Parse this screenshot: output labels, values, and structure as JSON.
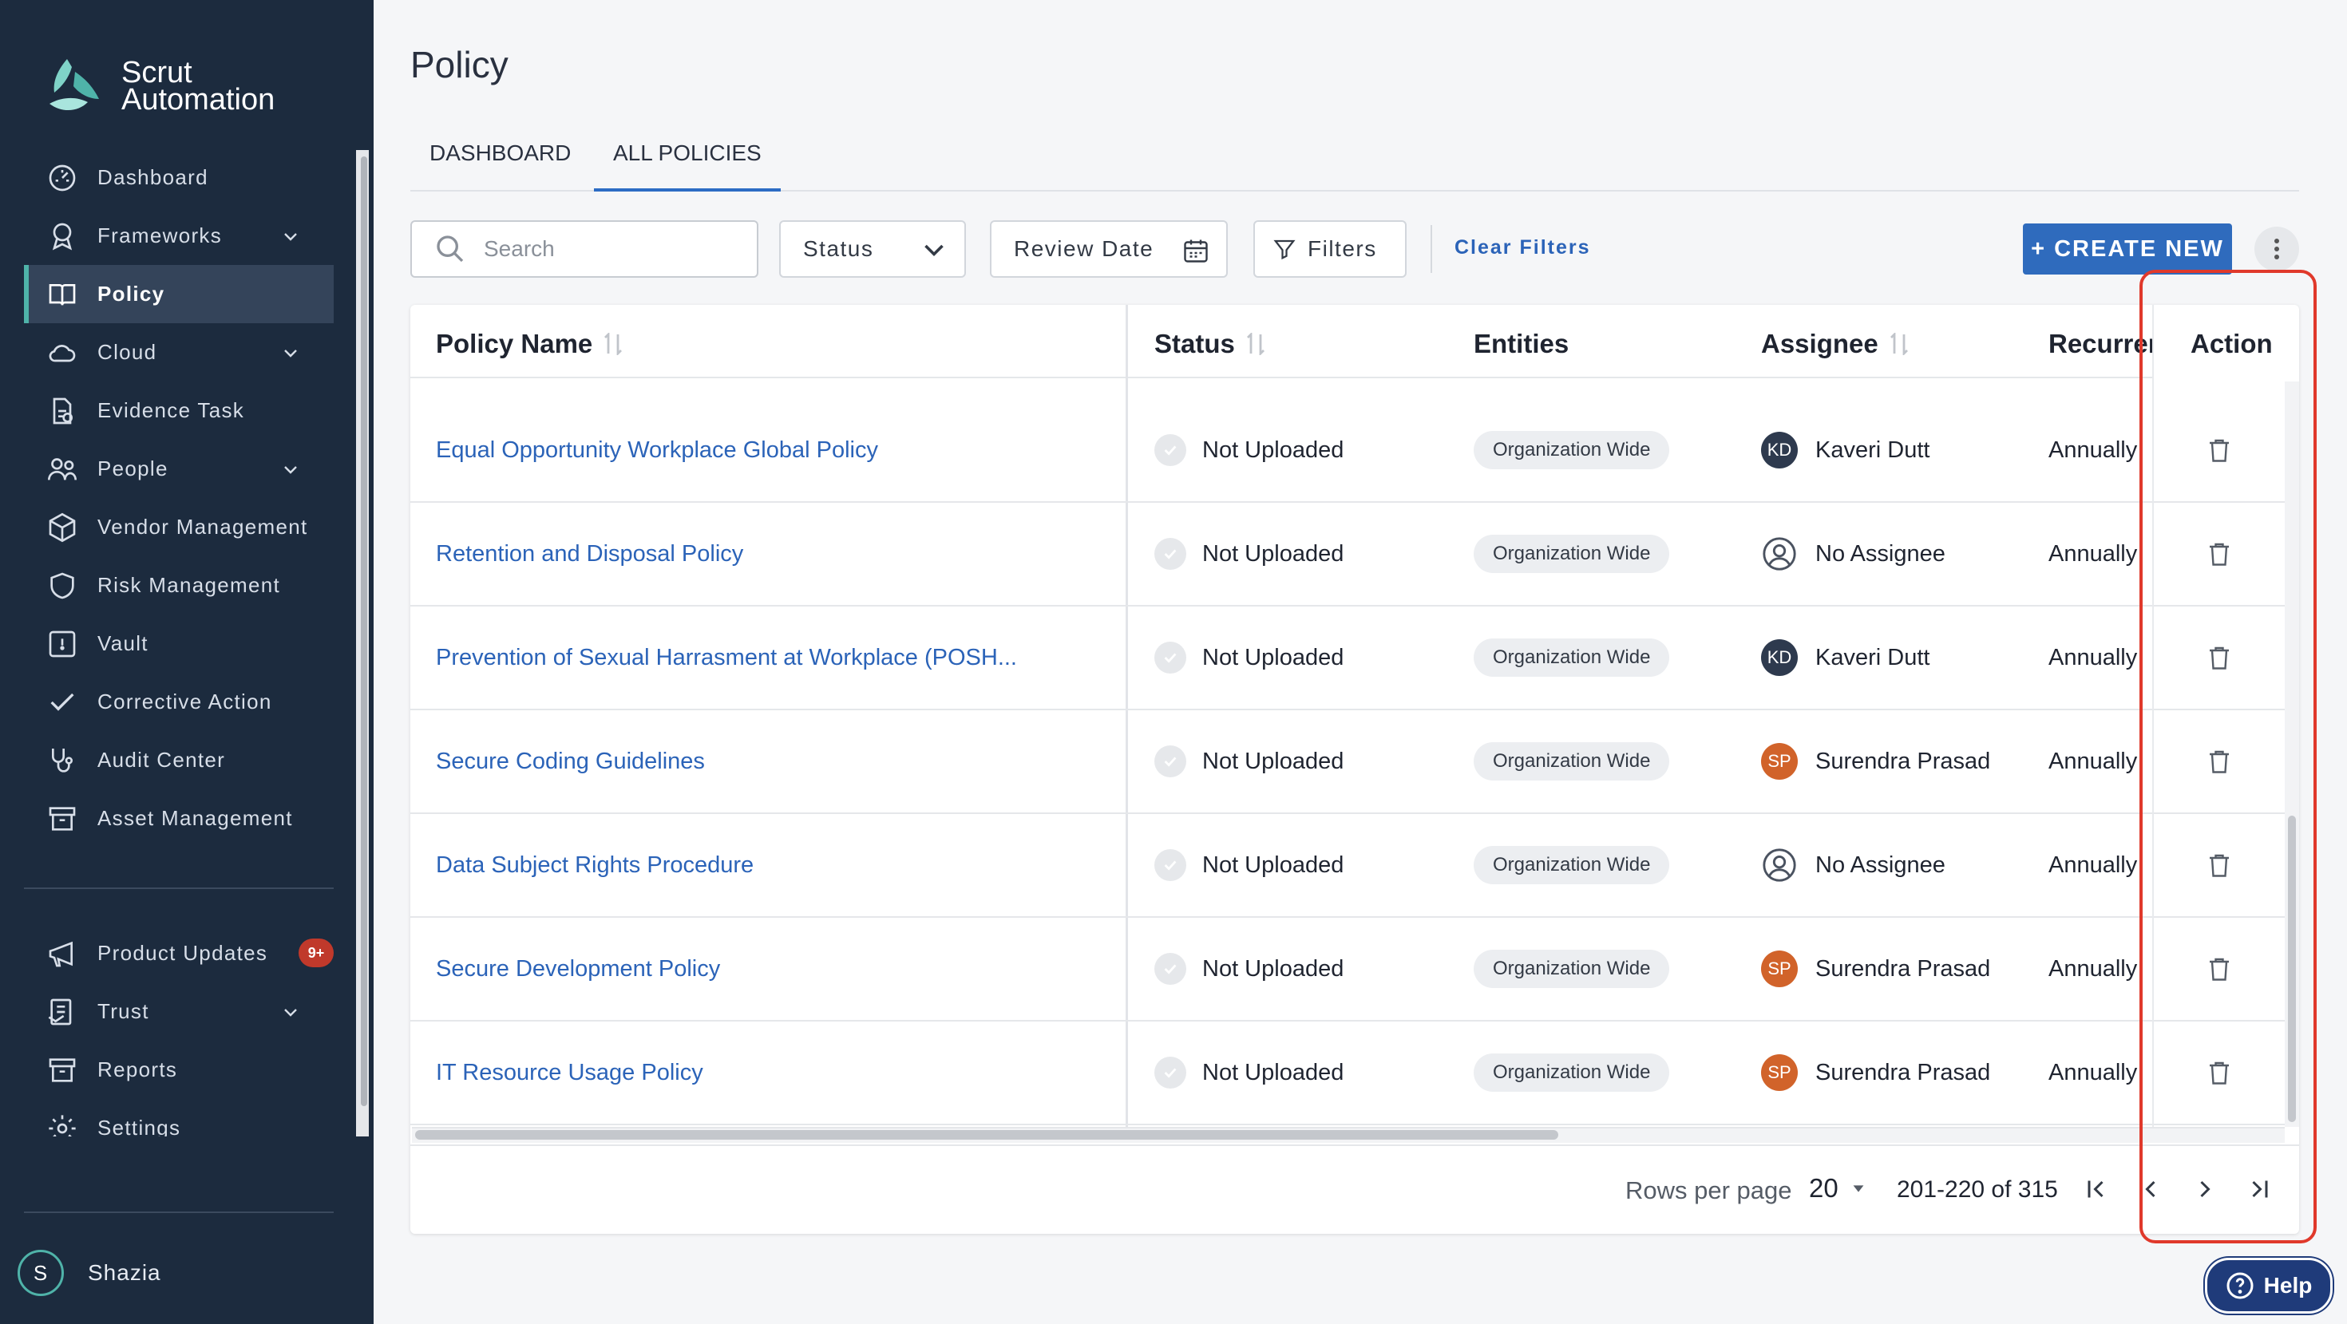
{
  "app": {
    "brand_line1": "Scrut",
    "brand_line2": "Automation",
    "accent_color": "#4fb3a9",
    "primary_color": "#2f6bbd"
  },
  "sidebar": {
    "items": [
      {
        "label": "Dashboard",
        "icon": "dashboard-icon"
      },
      {
        "label": "Frameworks",
        "icon": "frameworks-icon",
        "expandable": true
      },
      {
        "label": "Policy",
        "icon": "policy-icon",
        "active": true
      },
      {
        "label": "Cloud",
        "icon": "cloud-icon",
        "expandable": true
      },
      {
        "label": "Evidence Task",
        "icon": "evidence-icon"
      },
      {
        "label": "People",
        "icon": "people-icon",
        "expandable": true
      },
      {
        "label": "Vendor Management",
        "icon": "vendor-icon"
      },
      {
        "label": "Risk Management",
        "icon": "shield-icon"
      },
      {
        "label": "Vault",
        "icon": "vault-icon"
      },
      {
        "label": "Corrective Action",
        "icon": "check-icon"
      },
      {
        "label": "Audit Center",
        "icon": "stethoscope-icon"
      },
      {
        "label": "Asset Management",
        "icon": "archive-icon"
      }
    ],
    "bottom_items": [
      {
        "label": "Product Updates",
        "icon": "megaphone-icon",
        "badge": "9+"
      },
      {
        "label": "Trust",
        "icon": "trust-icon",
        "expandable": true
      },
      {
        "label": "Reports",
        "icon": "reports-icon"
      },
      {
        "label": "Settings",
        "icon": "settings-icon"
      }
    ],
    "user": {
      "initial": "S",
      "name": "Shazia"
    }
  },
  "header": {
    "title": "Policy",
    "tabs": [
      {
        "label": "DASHBOARD",
        "active": false
      },
      {
        "label": "ALL POLICIES",
        "active": true
      }
    ]
  },
  "toolbar": {
    "search_placeholder": "Search",
    "status_label": "Status",
    "review_date_label": "Review Date",
    "filters_label": "Filters",
    "clear_filters_label": "Clear Filters",
    "create_label": "+ CREATE NEW"
  },
  "table": {
    "columns": [
      "Policy Name",
      "Status",
      "Entities",
      "Assignee",
      "Recurrence",
      "Action"
    ],
    "rows": [
      {
        "name": "Equal Opportunity Workplace Global Policy",
        "status": "Not Uploaded",
        "entity": "Organization Wide",
        "assignee": "Kaveri Dutt",
        "initials": "KD",
        "avatar": "kd",
        "recurrence": "Annually"
      },
      {
        "name": "Retention and Disposal Policy",
        "status": "Not Uploaded",
        "entity": "Organization Wide",
        "assignee": "No Assignee",
        "initials": "",
        "avatar": "none",
        "recurrence": "Annually"
      },
      {
        "name": "Prevention of Sexual Harrasment at Workplace (POSH...",
        "status": "Not Uploaded",
        "entity": "Organization Wide",
        "assignee": "Kaveri Dutt",
        "initials": "KD",
        "avatar": "kd",
        "recurrence": "Annually"
      },
      {
        "name": "Secure Coding Guidelines",
        "status": "Not Uploaded",
        "entity": "Organization Wide",
        "assignee": "Surendra Prasad",
        "initials": "SP",
        "avatar": "sp",
        "recurrence": "Annually"
      },
      {
        "name": "Data Subject Rights Procedure",
        "status": "Not Uploaded",
        "entity": "Organization Wide",
        "assignee": "No Assignee",
        "initials": "",
        "avatar": "none",
        "recurrence": "Annually"
      },
      {
        "name": "Secure Development Policy",
        "status": "Not Uploaded",
        "entity": "Organization Wide",
        "assignee": "Surendra Prasad",
        "initials": "SP",
        "avatar": "sp",
        "recurrence": "Annually"
      },
      {
        "name": "IT Resource Usage Policy",
        "status": "Not Uploaded",
        "entity": "Organization Wide",
        "assignee": "Surendra Prasad",
        "initials": "SP",
        "avatar": "sp",
        "recurrence": "Annually"
      }
    ]
  },
  "pagination": {
    "rows_per_page_label": "Rows per page",
    "rows_per_page": "20",
    "range": "201-220 of 315"
  },
  "help": {
    "label": "Help"
  }
}
